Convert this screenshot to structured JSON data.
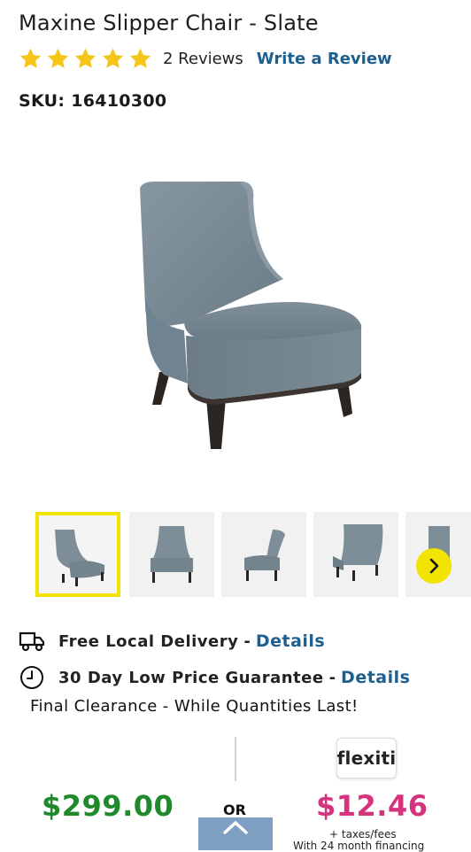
{
  "product": {
    "title": "Maxine Slipper Chair - Slate",
    "rating": 5,
    "reviews_label": "2 Reviews",
    "write_review_label": "Write a Review",
    "sku_label": "SKU: 16410300"
  },
  "gallery": {
    "main_image": "slate-slipper-chair-photo",
    "thumbnails": [
      {
        "view": "front-three-quarter",
        "selected": true
      },
      {
        "view": "front",
        "selected": false
      },
      {
        "view": "side",
        "selected": false
      },
      {
        "view": "back-three-quarter",
        "selected": false
      },
      {
        "view": "partial",
        "selected": false
      }
    ],
    "next_icon": "chevron-right-icon"
  },
  "info": {
    "delivery_label": "Free Local Delivery",
    "delivery_sep": "-",
    "delivery_link": "Details",
    "guarantee_label": "30 Day Low Price Guarantee",
    "guarantee_sep": "-",
    "guarantee_link": "Details",
    "clearance_text": "Final Clearance - While Quantities Last!"
  },
  "pricing": {
    "price": "$299.00",
    "or_label": "OR",
    "financing_logo": "flexiti",
    "monthly_price": "$12.46",
    "taxes_note": "+ taxes/fees",
    "financing_note": "With 24 month financing"
  },
  "colors": {
    "accent_yellow": "#f2e400",
    "link_blue": "#1d5f8f",
    "price_green": "#1f8a2c",
    "monthly_pink": "#d6337e",
    "star_yellow": "#f5c518",
    "scroll_button": "#7f9fc3"
  }
}
